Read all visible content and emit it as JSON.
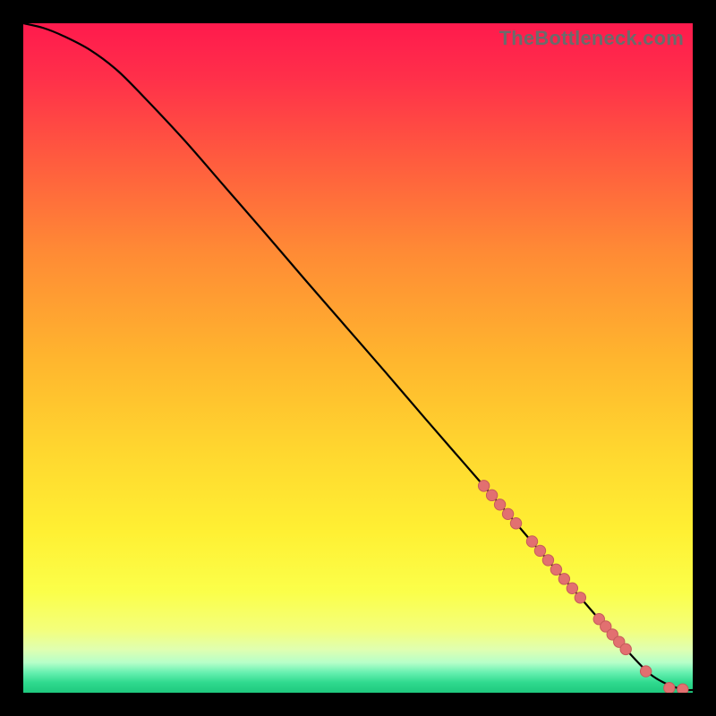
{
  "watermark": "TheBottleneck.com",
  "colors": {
    "frame": "#000000",
    "watermark": "#6b6b6b",
    "curve": "#000000",
    "marker_fill": "#e27070",
    "marker_stroke": "#c65b5b"
  },
  "chart_data": {
    "type": "line",
    "title": "",
    "xlabel": "",
    "ylabel": "",
    "xlim": [
      0,
      100
    ],
    "ylim": [
      0,
      100
    ],
    "grid": false,
    "legend": null,
    "annotations": [],
    "series": [
      {
        "name": "curve",
        "style": "line",
        "x": [
          0,
          3,
          6,
          10,
          14,
          18,
          24,
          30,
          36,
          42,
          48,
          54,
          60,
          66,
          72,
          76,
          80,
          82,
          84,
          86,
          90,
          94,
          98,
          100
        ],
        "y": [
          100,
          99.3,
          98.1,
          96.0,
          93.0,
          89.0,
          82.6,
          75.7,
          68.8,
          61.8,
          54.9,
          48.0,
          41.0,
          34.1,
          27.2,
          22.5,
          17.9,
          15.6,
          13.3,
          11.0,
          6.5,
          2.5,
          0.6,
          0.4
        ]
      },
      {
        "name": "markers",
        "style": "scatter",
        "x": [
          68.8,
          70.0,
          71.2,
          72.4,
          73.6,
          76.0,
          77.2,
          78.4,
          79.6,
          80.8,
          82.0,
          83.2,
          86.0,
          87.0,
          88.0,
          89.0,
          90.0,
          93.0,
          96.5,
          98.5
        ],
        "y": [
          30.9,
          29.5,
          28.1,
          26.7,
          25.3,
          22.6,
          21.2,
          19.8,
          18.4,
          17.0,
          15.6,
          14.2,
          11.0,
          9.9,
          8.7,
          7.6,
          6.5,
          3.2,
          0.7,
          0.5
        ]
      }
    ],
    "gradient_stops": [
      {
        "offset": 0.0,
        "color": "#ff1a4d"
      },
      {
        "offset": 0.08,
        "color": "#ff2f4a"
      },
      {
        "offset": 0.2,
        "color": "#ff5a3f"
      },
      {
        "offset": 0.34,
        "color": "#ff8a35"
      },
      {
        "offset": 0.5,
        "color": "#ffb52e"
      },
      {
        "offset": 0.64,
        "color": "#ffd72f"
      },
      {
        "offset": 0.76,
        "color": "#fff033"
      },
      {
        "offset": 0.85,
        "color": "#fbff4a"
      },
      {
        "offset": 0.905,
        "color": "#f4ff7a"
      },
      {
        "offset": 0.935,
        "color": "#e0ffb0"
      },
      {
        "offset": 0.955,
        "color": "#b6ffc9"
      },
      {
        "offset": 0.97,
        "color": "#66f0b0"
      },
      {
        "offset": 0.985,
        "color": "#2fd98e"
      },
      {
        "offset": 1.0,
        "color": "#1fc97e"
      }
    ]
  }
}
